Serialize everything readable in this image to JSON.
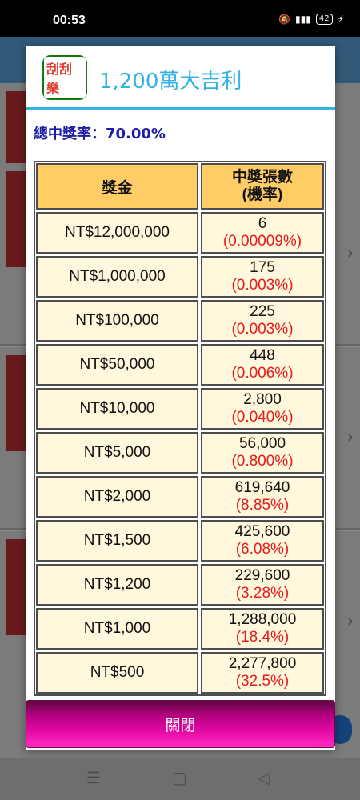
{
  "status_bar": {
    "time": "00:53",
    "battery": "42"
  },
  "dialog": {
    "logo_text": "刮刮樂",
    "title": "1,200萬大吉利",
    "total_win_rate": "總中獎率：70.00%",
    "table": {
      "headers": {
        "prize": "獎金",
        "count_line1": "中獎張數",
        "count_line2": "(機率)"
      },
      "rows": [
        {
          "prize": "NT$12,000,000",
          "count": "6",
          "rate": "(0.00009%)"
        },
        {
          "prize": "NT$1,000,000",
          "count": "175",
          "rate": "(0.003%)"
        },
        {
          "prize": "NT$100,000",
          "count": "225",
          "rate": "(0.003%)"
        },
        {
          "prize": "NT$50,000",
          "count": "448",
          "rate": "(0.006%)"
        },
        {
          "prize": "NT$10,000",
          "count": "2,800",
          "rate": "(0.040%)"
        },
        {
          "prize": "NT$5,000",
          "count": "56,000",
          "rate": "(0.800%)"
        },
        {
          "prize": "NT$2,000",
          "count": "619,640",
          "rate": "(8.85%)"
        },
        {
          "prize": "NT$1,500",
          "count": "425,600",
          "rate": "(6.08%)"
        },
        {
          "prize": "NT$1,200",
          "count": "229,600",
          "rate": "(3.28%)"
        },
        {
          "prize": "NT$1,000",
          "count": "1,288,000",
          "rate": "(18.4%)"
        },
        {
          "prize": "NT$500",
          "count": "2,277,800",
          "rate": "(32.5%)"
        }
      ]
    },
    "close_label": "關閉"
  },
  "colors": {
    "title": "#34b3e3",
    "rate_text": "#1c1ca8",
    "header_bg": "#ffcc66",
    "row_bg": "#fff8dc",
    "percent": "#e81a1a",
    "close_button": "#e40aa4"
  }
}
